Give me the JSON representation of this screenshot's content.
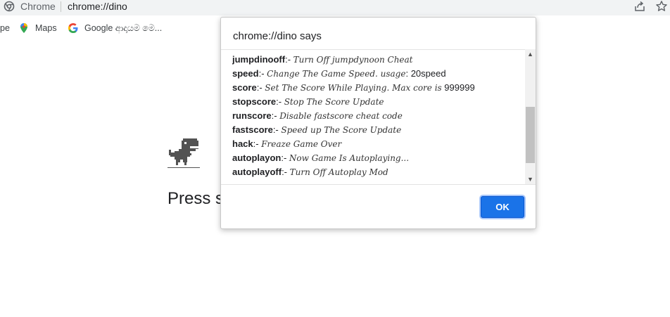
{
  "browser": {
    "site_name": "Chrome",
    "url": "chrome://dino",
    "bookmarks": [
      {
        "label": "pe",
        "icon": "bookmark-partial"
      },
      {
        "label": "Maps",
        "icon": "maps-pin-icon"
      },
      {
        "label": "Google ආදායම මෙ...",
        "icon": "google-icon"
      }
    ]
  },
  "page": {
    "press_text_visible": "Press sp"
  },
  "dialog": {
    "title": "chrome://dino says",
    "lines": [
      {
        "cmd": "jumpdinooff",
        "sep": ":- ",
        "desc": "Turn Off jumpdynoon Cheat"
      },
      {
        "cmd": "speed",
        "sep": ":- ",
        "desc": "Change The Game Speed. usage",
        "tail": ": 20speed"
      },
      {
        "cmd": "score",
        "sep": ":- ",
        "desc": "Set The Score While Playing. Max core is",
        "tail": " 999999"
      },
      {
        "cmd": "stopscore",
        "sep": ":- ",
        "desc": "Stop The Score Update"
      },
      {
        "cmd": "runscore",
        "sep": ":- ",
        "desc": "Disable fastscore cheat code"
      },
      {
        "cmd": "fastscore",
        "sep": ":- ",
        "desc": "Speed up The Score Update"
      },
      {
        "cmd": "hack",
        "sep": ":- ",
        "desc": "Freaze Game Over"
      },
      {
        "cmd": "autoplayon",
        "sep": ":- ",
        "desc": "Now Game Is Autoplaying..."
      },
      {
        "cmd": "autoplayoff",
        "sep": ":- ",
        "desc": "Turn Off Autoplay Mod"
      }
    ],
    "ok_label": "OK"
  },
  "colors": {
    "ok_button": "#1a73e8",
    "dialog_border": "#c8c8c8"
  }
}
